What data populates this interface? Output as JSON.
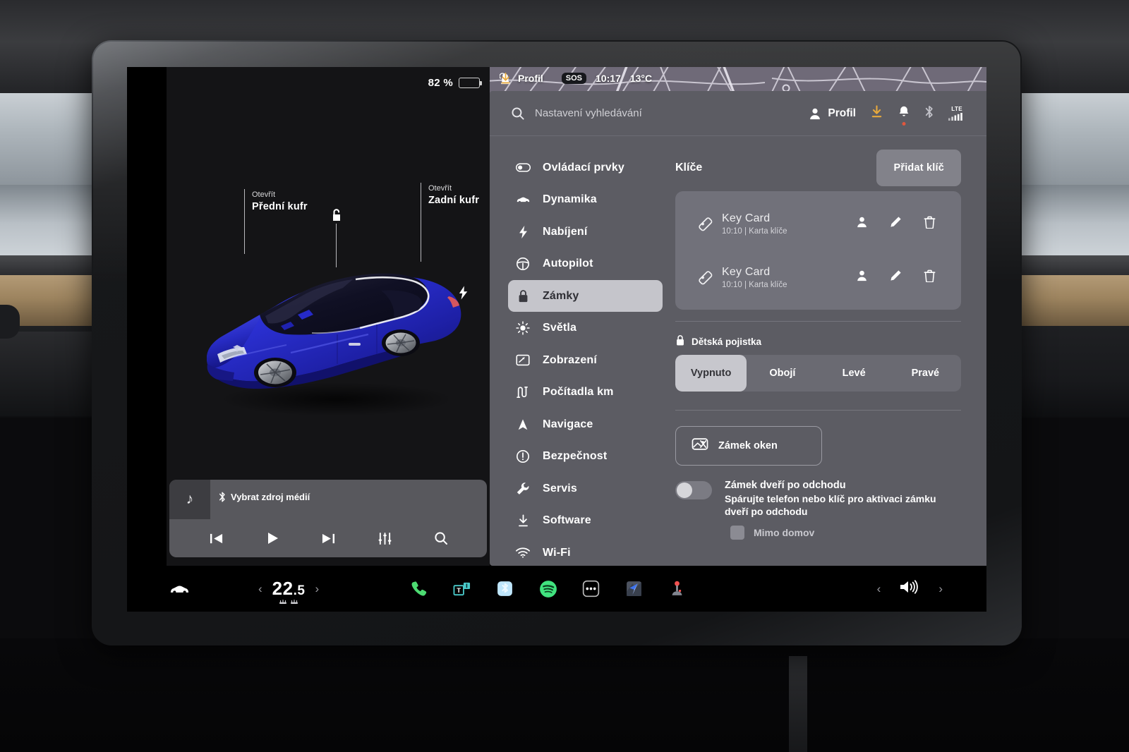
{
  "vehicle_panel": {
    "battery_percent": "82 %",
    "callouts": [
      {
        "sub": "Otevřít",
        "main": "Přední kufr",
        "icon": "frunk-open-icon"
      },
      {
        "sub": "Otevřít",
        "main": "Zadní kufr",
        "icon": "trunk-open-icon"
      }
    ],
    "unlock_icon": "unlock-icon",
    "charge_port_icon": "charge-bolt-icon",
    "car_image_alt": "tesla-model-3-blue"
  },
  "media_player": {
    "source_label": "Vybrat zdroj médií",
    "source_icon": "bluetooth-icon",
    "album_icon": "music-note-icon",
    "controls": [
      {
        "name": "previous-track-button",
        "icon": "skip-back-icon"
      },
      {
        "name": "play-button",
        "icon": "play-icon"
      },
      {
        "name": "next-track-button",
        "icon": "skip-forward-icon"
      },
      {
        "name": "equalizer-button",
        "icon": "sliders-icon"
      },
      {
        "name": "media-search-button",
        "icon": "search-icon"
      }
    ]
  },
  "map_status_bar": {
    "lock_icon": "unlocked-padlock-icon",
    "profile_icon": "person-icon",
    "profile_label": "Profil",
    "download_icon": "download-icon",
    "sos_label": "SOS",
    "time": "10:17",
    "temperature": "13°C"
  },
  "settings": {
    "search": {
      "placeholder": "Nastavení vyhledávání",
      "icon": "search-icon"
    },
    "header_right": {
      "profile_label": "Profil",
      "profile_icon": "person-icon",
      "download_icon": "download-icon",
      "bell_icon": "bell-icon",
      "bluetooth_icon": "bluetooth-icon",
      "network_label": "LTE",
      "signal_icon": "signal-bars-icon"
    },
    "nav_items": [
      {
        "label": "Ovládací prvky",
        "icon": "toggle-switch-icon",
        "active": false
      },
      {
        "label": "Dynamika",
        "icon": "car-icon",
        "active": false
      },
      {
        "label": "Nabíjení",
        "icon": "bolt-icon",
        "active": false
      },
      {
        "label": "Autopilot",
        "icon": "steering-wheel-icon",
        "active": false
      },
      {
        "label": "Zámky",
        "icon": "padlock-icon",
        "active": true
      },
      {
        "label": "Světla",
        "icon": "sun-icon",
        "active": false
      },
      {
        "label": "Zobrazení",
        "icon": "display-icon",
        "active": false
      },
      {
        "label": "Počítadla km",
        "icon": "odometer-icon",
        "active": false
      },
      {
        "label": "Navigace",
        "icon": "navigation-arrow-icon",
        "active": false
      },
      {
        "label": "Bezpečnost",
        "icon": "alert-circle-icon",
        "active": false
      },
      {
        "label": "Servis",
        "icon": "wrench-icon",
        "active": false
      },
      {
        "label": "Software",
        "icon": "download-icon",
        "active": false
      },
      {
        "label": "Wi-Fi",
        "icon": "wifi-icon",
        "active": false
      }
    ],
    "keys_section": {
      "title": "Klíče",
      "add_button": "Přidat klíč",
      "rows": [
        {
          "name": "Key Card",
          "meta": "10:10 | Karta klíče",
          "icon": "key-card-icon",
          "actions": [
            "person-icon",
            "pencil-icon",
            "trash-icon"
          ]
        },
        {
          "name": "Key Card",
          "meta": "10:10 | Karta klíče",
          "icon": "key-card-icon",
          "actions": [
            "person-icon",
            "pencil-icon",
            "trash-icon"
          ]
        }
      ]
    },
    "child_lock": {
      "label": "Dětská pojistka",
      "icon": "padlock-icon",
      "options": [
        "Vypnuto",
        "Obojí",
        "Levé",
        "Pravé"
      ],
      "selected": "Vypnuto"
    },
    "window_lock": {
      "label": "Zámek oken",
      "icon": "window-lock-icon"
    },
    "walk_away_lock": {
      "title": "Zámek dveří po odchodu",
      "description": "Spárujte telefon nebo klíč pro aktivaci zámku dveří po odchodu",
      "enabled": false,
      "checkbox_label": "Mimo domov",
      "checkbox_checked": false
    }
  },
  "taskbar": {
    "car_icon": "car-front-icon",
    "temperature": {
      "value": "22",
      "decimal": ".5",
      "prev_icon": "chevron-left-icon",
      "next_icon": "chevron-right-icon",
      "vent_icon": "vent-icon"
    },
    "apps": [
      {
        "name": "phone-app",
        "icon": "phone-icon"
      },
      {
        "name": "tidal-app",
        "icon": "tidal-icon"
      },
      {
        "name": "bluetooth-audio-app",
        "icon": "bluetooth-app-icon"
      },
      {
        "name": "spotify-app",
        "icon": "spotify-icon"
      },
      {
        "name": "more-apps",
        "icon": "ellipsis-icon"
      },
      {
        "name": "navigation-app",
        "icon": "map-arrow-icon"
      },
      {
        "name": "arcade-app",
        "icon": "joystick-icon"
      }
    ],
    "volume": {
      "icon": "speaker-icon",
      "prev_icon": "chevron-left-icon",
      "next_icon": "chevron-right-icon"
    }
  },
  "colors": {
    "screen_bg": "#000000",
    "panel_bg": "#141416",
    "settings_bg": "#5c5c63",
    "card_bg": "#71717a",
    "accent_selected": "#c5c5cb",
    "car_blue": "#2a2fd0",
    "spotify_green": "#1db954",
    "phone_green": "#30d158",
    "alert_red": "#e0573e",
    "download_amber": "#e0a33e"
  }
}
